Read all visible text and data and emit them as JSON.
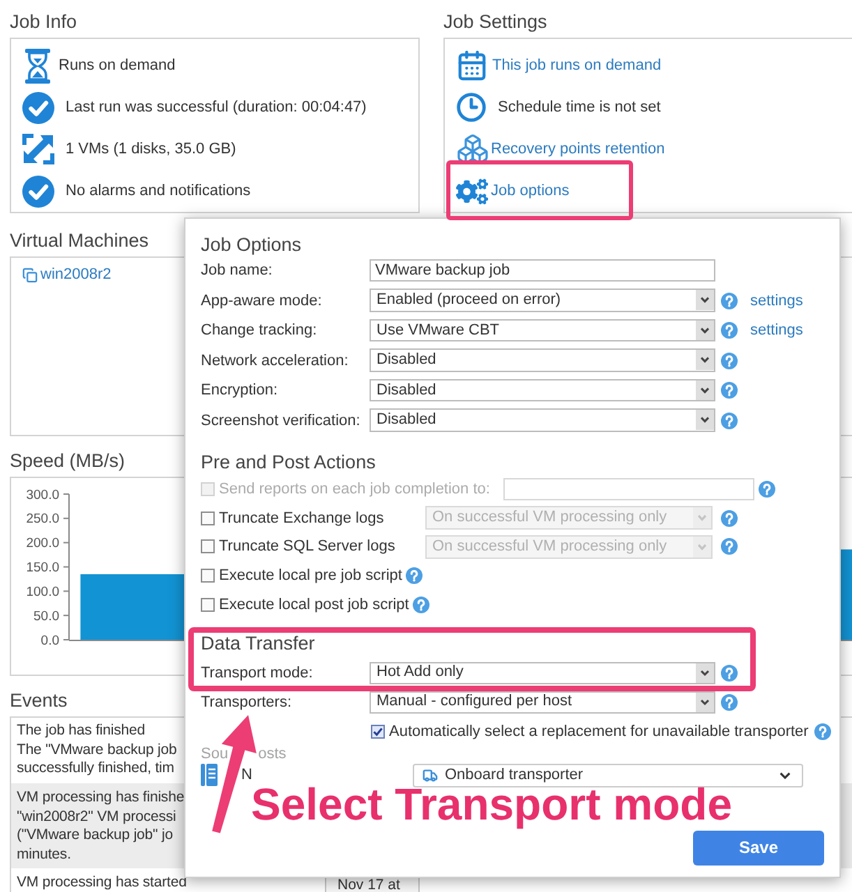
{
  "job_info": {
    "title": "Job Info",
    "items": [
      "Runs on demand",
      "Last run was successful (duration: 00:04:47)",
      "1 VMs (1 disks, 35.0 GB)",
      "No alarms and notifications"
    ]
  },
  "job_settings": {
    "title": "Job Settings",
    "items": [
      {
        "text": "This job runs on demand",
        "link": true,
        "highlighted": false
      },
      {
        "text": "Schedule time is not set",
        "link": false,
        "highlighted": false
      },
      {
        "text": "Recovery points retention",
        "link": true,
        "highlighted": false
      },
      {
        "text": "Job options",
        "link": true,
        "highlighted": true
      }
    ]
  },
  "virtual_machines": {
    "title": "Virtual Machines",
    "items": [
      "win2008r2"
    ]
  },
  "speed": {
    "title": "Speed (MB/s)",
    "chart_data": {
      "type": "bar",
      "categories": [
        null,
        null
      ],
      "values": [
        135,
        186
      ],
      "ylim": [
        0,
        300
      ],
      "yticks": [
        {
          "value": 0,
          "label": "0.0"
        },
        {
          "value": 50,
          "label": "50.0"
        },
        {
          "value": 100,
          "label": "100.0"
        },
        {
          "value": 150,
          "label": "150.0"
        },
        {
          "value": 200,
          "label": "200.0"
        },
        {
          "value": 250,
          "label": "250.0"
        },
        {
          "value": 300,
          "label": "300.0"
        }
      ]
    }
  },
  "events": {
    "title": "Events",
    "rows": [
      {
        "lines": [
          "The job has finished",
          "The \"VMware backup job",
          "successfully finished, tim"
        ]
      },
      {
        "lines": [
          "VM processing has finishe",
          "\"win2008r2\" VM processi",
          "(\"VMware backup job\" jo",
          "minutes."
        ]
      },
      {
        "lines": [
          "VM processing has started"
        ],
        "date": "Nov 17 at"
      }
    ]
  },
  "dialog": {
    "job_options": {
      "title": "Job Options",
      "rows": [
        {
          "kind": "text",
          "label": "Job name:",
          "value": "VMware backup job",
          "help": false
        },
        {
          "kind": "select",
          "label": "App-aware mode:",
          "value": "Enabled (proceed on error)",
          "help": true,
          "link": "settings"
        },
        {
          "kind": "select",
          "label": "Change tracking:",
          "value": "Use VMware CBT",
          "help": true,
          "link": "settings"
        },
        {
          "kind": "select",
          "label": "Network acceleration:",
          "value": "Disabled",
          "help": true
        },
        {
          "kind": "select",
          "label": "Encryption:",
          "value": "Disabled",
          "help": true
        },
        {
          "kind": "select",
          "label": "Screenshot verification:",
          "value": "Disabled",
          "help": true
        }
      ]
    },
    "pre_post_actions": {
      "title": "Pre and Post Actions",
      "rows": [
        {
          "kind": "checkbox_field",
          "label": "Send reports on each job completion to:",
          "checked": false,
          "disabled": true,
          "help": true
        },
        {
          "kind": "checkbox_select",
          "label": "Truncate Exchange logs",
          "checked": false,
          "disabled": false,
          "option": "On successful VM processing only",
          "option_disabled": true,
          "help": true
        },
        {
          "kind": "checkbox_select",
          "label": "Truncate SQL Server logs",
          "checked": false,
          "disabled": false,
          "option": "On successful VM processing only",
          "option_disabled": true,
          "help": true
        },
        {
          "kind": "checkbox",
          "label": "Execute local pre job script",
          "checked": false,
          "disabled": false,
          "help": true
        },
        {
          "kind": "checkbox",
          "label": "Execute local post job script",
          "checked": false,
          "disabled": false,
          "help": true
        }
      ]
    },
    "data_transfer": {
      "title": "Data Transfer",
      "highlighted": true,
      "rows": [
        {
          "label": "Transport mode:",
          "value": "Hot Add only",
          "help": true
        },
        {
          "label": "Transporters:",
          "value": "Manual - configured per host",
          "help": true
        }
      ],
      "auto_replace": {
        "label": "Automatically select a replacement for unavailable transporter",
        "checked": true,
        "help": true
      },
      "source_hosts": {
        "title_parts": [
          "Sou",
          "osts"
        ],
        "hosts": [
          {
            "name_parts": [
              "N"
            ],
            "transporter": "Onboard transporter"
          }
        ]
      }
    },
    "save_button": "Save"
  },
  "callout": {
    "text": "Select Transport mode"
  }
}
